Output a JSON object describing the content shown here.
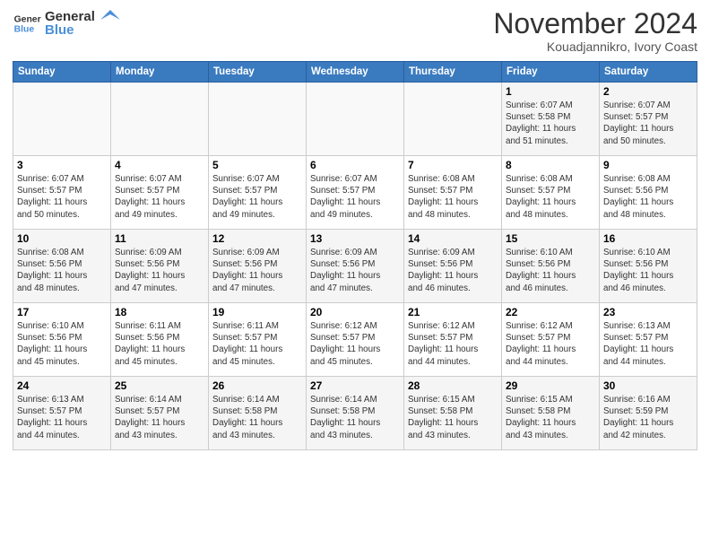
{
  "logo": {
    "line1": "General",
    "line2": "Blue"
  },
  "title": "November 2024",
  "location": "Kouadjannikro, Ivory Coast",
  "weekdays": [
    "Sunday",
    "Monday",
    "Tuesday",
    "Wednesday",
    "Thursday",
    "Friday",
    "Saturday"
  ],
  "weeks": [
    [
      {
        "day": "",
        "info": ""
      },
      {
        "day": "",
        "info": ""
      },
      {
        "day": "",
        "info": ""
      },
      {
        "day": "",
        "info": ""
      },
      {
        "day": "",
        "info": ""
      },
      {
        "day": "1",
        "info": "Sunrise: 6:07 AM\nSunset: 5:58 PM\nDaylight: 11 hours\nand 51 minutes."
      },
      {
        "day": "2",
        "info": "Sunrise: 6:07 AM\nSunset: 5:57 PM\nDaylight: 11 hours\nand 50 minutes."
      }
    ],
    [
      {
        "day": "3",
        "info": "Sunrise: 6:07 AM\nSunset: 5:57 PM\nDaylight: 11 hours\nand 50 minutes."
      },
      {
        "day": "4",
        "info": "Sunrise: 6:07 AM\nSunset: 5:57 PM\nDaylight: 11 hours\nand 49 minutes."
      },
      {
        "day": "5",
        "info": "Sunrise: 6:07 AM\nSunset: 5:57 PM\nDaylight: 11 hours\nand 49 minutes."
      },
      {
        "day": "6",
        "info": "Sunrise: 6:07 AM\nSunset: 5:57 PM\nDaylight: 11 hours\nand 49 minutes."
      },
      {
        "day": "7",
        "info": "Sunrise: 6:08 AM\nSunset: 5:57 PM\nDaylight: 11 hours\nand 48 minutes."
      },
      {
        "day": "8",
        "info": "Sunrise: 6:08 AM\nSunset: 5:57 PM\nDaylight: 11 hours\nand 48 minutes."
      },
      {
        "day": "9",
        "info": "Sunrise: 6:08 AM\nSunset: 5:56 PM\nDaylight: 11 hours\nand 48 minutes."
      }
    ],
    [
      {
        "day": "10",
        "info": "Sunrise: 6:08 AM\nSunset: 5:56 PM\nDaylight: 11 hours\nand 48 minutes."
      },
      {
        "day": "11",
        "info": "Sunrise: 6:09 AM\nSunset: 5:56 PM\nDaylight: 11 hours\nand 47 minutes."
      },
      {
        "day": "12",
        "info": "Sunrise: 6:09 AM\nSunset: 5:56 PM\nDaylight: 11 hours\nand 47 minutes."
      },
      {
        "day": "13",
        "info": "Sunrise: 6:09 AM\nSunset: 5:56 PM\nDaylight: 11 hours\nand 47 minutes."
      },
      {
        "day": "14",
        "info": "Sunrise: 6:09 AM\nSunset: 5:56 PM\nDaylight: 11 hours\nand 46 minutes."
      },
      {
        "day": "15",
        "info": "Sunrise: 6:10 AM\nSunset: 5:56 PM\nDaylight: 11 hours\nand 46 minutes."
      },
      {
        "day": "16",
        "info": "Sunrise: 6:10 AM\nSunset: 5:56 PM\nDaylight: 11 hours\nand 46 minutes."
      }
    ],
    [
      {
        "day": "17",
        "info": "Sunrise: 6:10 AM\nSunset: 5:56 PM\nDaylight: 11 hours\nand 45 minutes."
      },
      {
        "day": "18",
        "info": "Sunrise: 6:11 AM\nSunset: 5:56 PM\nDaylight: 11 hours\nand 45 minutes."
      },
      {
        "day": "19",
        "info": "Sunrise: 6:11 AM\nSunset: 5:57 PM\nDaylight: 11 hours\nand 45 minutes."
      },
      {
        "day": "20",
        "info": "Sunrise: 6:12 AM\nSunset: 5:57 PM\nDaylight: 11 hours\nand 45 minutes."
      },
      {
        "day": "21",
        "info": "Sunrise: 6:12 AM\nSunset: 5:57 PM\nDaylight: 11 hours\nand 44 minutes."
      },
      {
        "day": "22",
        "info": "Sunrise: 6:12 AM\nSunset: 5:57 PM\nDaylight: 11 hours\nand 44 minutes."
      },
      {
        "day": "23",
        "info": "Sunrise: 6:13 AM\nSunset: 5:57 PM\nDaylight: 11 hours\nand 44 minutes."
      }
    ],
    [
      {
        "day": "24",
        "info": "Sunrise: 6:13 AM\nSunset: 5:57 PM\nDaylight: 11 hours\nand 44 minutes."
      },
      {
        "day": "25",
        "info": "Sunrise: 6:14 AM\nSunset: 5:57 PM\nDaylight: 11 hours\nand 43 minutes."
      },
      {
        "day": "26",
        "info": "Sunrise: 6:14 AM\nSunset: 5:58 PM\nDaylight: 11 hours\nand 43 minutes."
      },
      {
        "day": "27",
        "info": "Sunrise: 6:14 AM\nSunset: 5:58 PM\nDaylight: 11 hours\nand 43 minutes."
      },
      {
        "day": "28",
        "info": "Sunrise: 6:15 AM\nSunset: 5:58 PM\nDaylight: 11 hours\nand 43 minutes."
      },
      {
        "day": "29",
        "info": "Sunrise: 6:15 AM\nSunset: 5:58 PM\nDaylight: 11 hours\nand 43 minutes."
      },
      {
        "day": "30",
        "info": "Sunrise: 6:16 AM\nSunset: 5:59 PM\nDaylight: 11 hours\nand 42 minutes."
      }
    ]
  ]
}
